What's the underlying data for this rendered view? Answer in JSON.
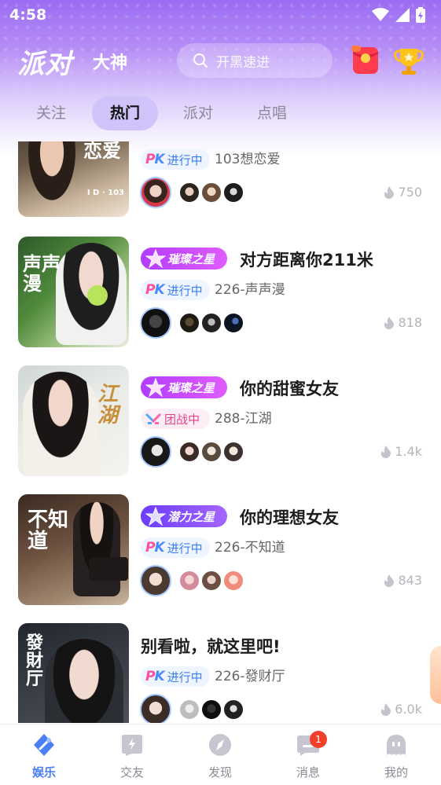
{
  "status_bar": {
    "time": "4:58"
  },
  "header": {
    "brand": "派对",
    "secondary": "大神",
    "search_placeholder": "开黑速进",
    "icons": [
      "red-packet-icon",
      "trophy-icon"
    ]
  },
  "tabs": [
    {
      "label": "关注",
      "active": false
    },
    {
      "label": "热门",
      "active": true
    },
    {
      "label": "派对",
      "active": false
    },
    {
      "label": "点唱",
      "active": false
    }
  ],
  "rooms": [
    {
      "cover_title": "恋爱",
      "cover_sub": "I D · 103",
      "badge": "",
      "title": "",
      "status": "进行中",
      "status_type": "pk",
      "room": "103想恋爱",
      "heat": "750"
    },
    {
      "cover_title": "声声漫",
      "cover_sub": "",
      "badge": "璀璨之星",
      "title": "对方距离你211米",
      "status": "进行中",
      "status_type": "pk",
      "room": "226-声声漫",
      "heat": "818"
    },
    {
      "cover_title": "江湖",
      "cover_sub": "",
      "badge": "璀璨之星",
      "title": "你的甜蜜女友",
      "status": "团战中",
      "status_type": "team",
      "room": "288-江湖",
      "heat": "1.4k"
    },
    {
      "cover_title": "不知道",
      "cover_sub": "",
      "badge": "潜力之星",
      "title": "你的理想女友",
      "status": "进行中",
      "status_type": "pk",
      "room": "226-不知道",
      "heat": "843"
    },
    {
      "cover_title": "發財厅",
      "cover_sub": "",
      "badge": "",
      "title": "别看啦，就这里吧!",
      "status": "进行中",
      "status_type": "pk",
      "room": "226-發财厅",
      "heat": "6.0k"
    }
  ],
  "pk_label": "PK",
  "bottom_nav": [
    {
      "label": "娱乐",
      "active": true,
      "icon": "entertainment-icon"
    },
    {
      "label": "交友",
      "active": false,
      "icon": "friends-icon"
    },
    {
      "label": "发现",
      "active": false,
      "icon": "compass-icon"
    },
    {
      "label": "消息",
      "active": false,
      "icon": "message-icon",
      "badge": "1"
    },
    {
      "label": "我的",
      "active": false,
      "icon": "profile-icon"
    }
  ],
  "colors": {
    "accent": "#4a7ef5",
    "header_gradient_top": "#9a6cf3",
    "badge_bright": "#c341ff",
    "badge_potential": "#7b4cff",
    "notification": "#f0402b"
  }
}
